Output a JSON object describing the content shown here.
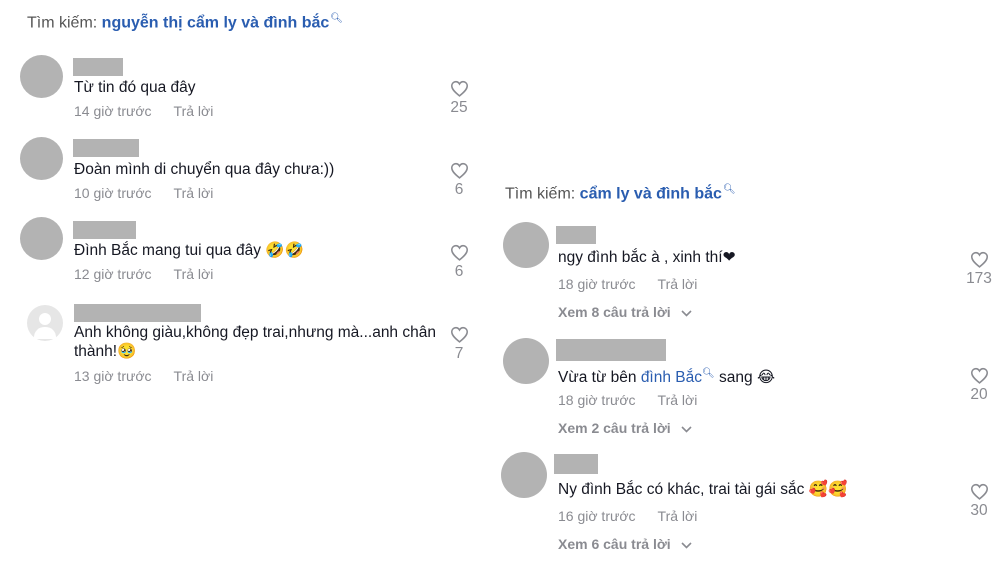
{
  "left": {
    "search_label": "Tìm kiếm:",
    "search_keyword": "nguyễn thị cẩm ly và đình bắc",
    "comments": [
      {
        "text": "Từ tin đó qua đây",
        "time": "14 giờ trước",
        "reply": "Trả lời",
        "likes": "25"
      },
      {
        "text": "Đoàn mình di chuyển qua đây chưa:))",
        "time": "10 giờ trước",
        "reply": "Trả lời",
        "likes": "6"
      },
      {
        "text": "Đình Bắc mang tui qua đây 🤣🤣",
        "time": "12 giờ trước",
        "reply": "Trả lời",
        "likes": "6"
      },
      {
        "text": "Anh không giàu,không đẹp trai,nhưng mà...anh chân thành!🥹",
        "time": "13 giờ trước",
        "reply": "Trả lời",
        "likes": "7"
      }
    ]
  },
  "right": {
    "search_label": "Tìm kiếm:",
    "search_keyword": "cẩm ly và đình bắc",
    "comments": [
      {
        "text": "ngy đình bắc à , xinh thí❤",
        "time": "18 giờ trước",
        "reply": "Trả lời",
        "likes": "173",
        "view_replies": "Xem 8 câu trả lời"
      },
      {
        "text_before": "Vừa từ bên ",
        "tag": "đình Bắc",
        "text_after": " sang 😂",
        "time": "18 giờ trước",
        "reply": "Trả lời",
        "likes": "20",
        "view_replies": "Xem 2 câu trả lời"
      },
      {
        "text": "Ny đình Bắc có khác, trai tài gái sắc 🥰🥰",
        "time": "16 giờ trước",
        "reply": "Trả lời",
        "likes": "30",
        "view_replies": "Xem 6 câu trả lời"
      }
    ]
  },
  "icons": {
    "search": "search-icon",
    "like": "heart-outline-icon",
    "chevron": "chevron-down-icon"
  },
  "colors": {
    "keyword": "#2a5db0",
    "meta": "#8a8b91",
    "redacted": "#b3b3b3"
  }
}
